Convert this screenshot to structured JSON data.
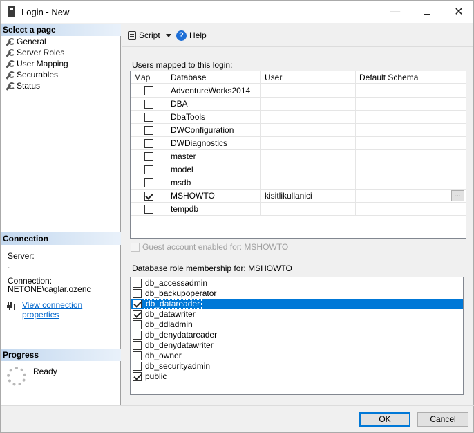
{
  "window": {
    "title": "Login - New"
  },
  "left": {
    "select_page_header": "Select a page",
    "pages": [
      {
        "label": "General"
      },
      {
        "label": "Server Roles"
      },
      {
        "label": "User Mapping"
      },
      {
        "label": "Securables"
      },
      {
        "label": "Status"
      }
    ],
    "connection_header": "Connection",
    "server_label": "Server:",
    "server_value": ".",
    "connection_label": "Connection:",
    "connection_value": "NETONE\\caglar.ozenc",
    "view_connection_link": "View connection properties",
    "progress_header": "Progress",
    "progress_status": "Ready"
  },
  "toolbar": {
    "script_label": "Script",
    "help_label": "Help"
  },
  "mapping": {
    "title": "Users mapped to this login:",
    "columns": [
      "Map",
      "Database",
      "User",
      "Default Schema"
    ],
    "rows": [
      {
        "checked": false,
        "database": "AdventureWorks2014",
        "user": "",
        "schema": ""
      },
      {
        "checked": false,
        "database": "DBA",
        "user": "",
        "schema": ""
      },
      {
        "checked": false,
        "database": "DbaTools",
        "user": "",
        "schema": ""
      },
      {
        "checked": false,
        "database": "DWConfiguration",
        "user": "",
        "schema": ""
      },
      {
        "checked": false,
        "database": "DWDiagnostics",
        "user": "",
        "schema": ""
      },
      {
        "checked": false,
        "database": "master",
        "user": "",
        "schema": ""
      },
      {
        "checked": false,
        "database": "model",
        "user": "",
        "schema": ""
      },
      {
        "checked": false,
        "database": "msdb",
        "user": "",
        "schema": ""
      },
      {
        "checked": true,
        "database": "MSHOWTO",
        "user": "kisitlikullanici",
        "schema": "",
        "ellipsis": "..."
      },
      {
        "checked": false,
        "database": "tempdb",
        "user": "",
        "schema": ""
      }
    ]
  },
  "guest": {
    "label": "Guest account enabled for: MSHOWTO",
    "checked": false
  },
  "roles": {
    "title": "Database role membership for: MSHOWTO",
    "items": [
      {
        "name": "db_accessadmin",
        "checked": false
      },
      {
        "name": "db_backupoperator",
        "checked": false
      },
      {
        "name": "db_datareader",
        "checked": true,
        "selected": true
      },
      {
        "name": "db_datawriter",
        "checked": true
      },
      {
        "name": "db_ddladmin",
        "checked": false
      },
      {
        "name": "db_denydatareader",
        "checked": false
      },
      {
        "name": "db_denydatawriter",
        "checked": false
      },
      {
        "name": "db_owner",
        "checked": false
      },
      {
        "name": "db_securityadmin",
        "checked": false
      },
      {
        "name": "public",
        "checked": true
      }
    ]
  },
  "buttons": {
    "ok": "OK",
    "cancel": "Cancel"
  },
  "colors": {
    "accent": "#0078d7",
    "link": "#0066cc",
    "header_gradient": "#c3d8ef"
  }
}
